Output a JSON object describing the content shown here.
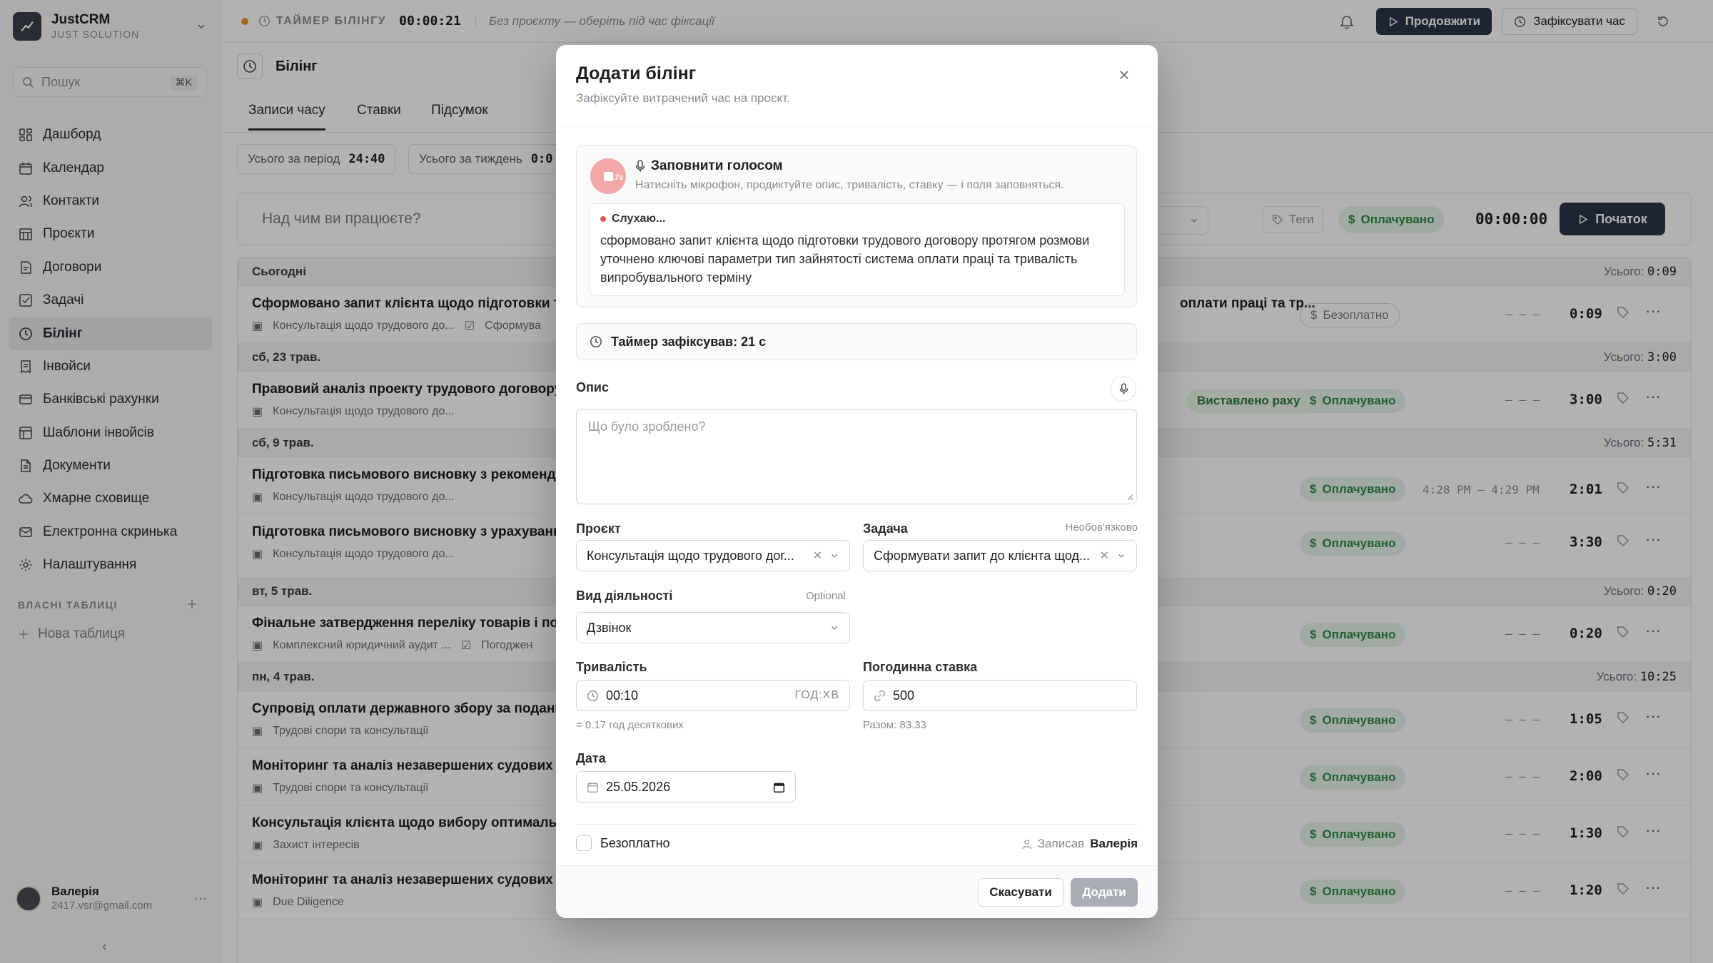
{
  "brand": {
    "name": "JustCRM",
    "subtitle": "JUST SOLUTION"
  },
  "search": {
    "placeholder": "Пошук",
    "shortcut": "⌘K"
  },
  "nav": [
    {
      "label": "Дашборд",
      "icon": "dashboard-icon"
    },
    {
      "label": "Календар",
      "icon": "calendar-icon"
    },
    {
      "label": "Контакти",
      "icon": "contacts-icon"
    },
    {
      "label": "Проєкти",
      "icon": "projects-icon"
    },
    {
      "label": "Договори",
      "icon": "contracts-icon"
    },
    {
      "label": "Задачі",
      "icon": "tasks-icon"
    },
    {
      "label": "Білінг",
      "icon": "billing-icon",
      "active": true
    },
    {
      "label": "Інвойси",
      "icon": "invoices-icon"
    },
    {
      "label": "Банківські рахунки",
      "icon": "bank-icon"
    },
    {
      "label": "Шаблони інвойсів",
      "icon": "templates-icon"
    },
    {
      "label": "Документи",
      "icon": "documents-icon"
    },
    {
      "label": "Хмарне сховище",
      "icon": "cloud-icon"
    },
    {
      "label": "Електронна скринька",
      "icon": "mail-icon"
    },
    {
      "label": "Налаштування",
      "icon": "settings-icon"
    }
  ],
  "custom_tables": {
    "label": "ВЛАСНІ ТАБЛИЦІ",
    "new": "Нова таблиця"
  },
  "user": {
    "name": "Валерія",
    "email": "2417.vsr@gmail.com"
  },
  "topbar": {
    "timer_label": "ТАЙМЕР БІЛІНГУ",
    "timer_value": "00:00:21",
    "project_hint": "Без проєкту — оберіть під час фіксації",
    "continue": "Продовжити",
    "fix_time": "Зафіксувати час"
  },
  "page": {
    "title": "Білінг",
    "tabs": [
      "Записи часу",
      "Ставки",
      "Підсумок"
    ],
    "total_period_label": "Усього за період",
    "total_period": "24:40",
    "total_week_label": "Усього за тиждень",
    "total_week": "0:0"
  },
  "workbar": {
    "placeholder": "Над чим ви працюєте?",
    "tags": "Теги",
    "billable": "Оплачувано",
    "time": "00:00:00",
    "start": "Початок"
  },
  "list": {
    "total_label": "Усього:",
    "days": [
      {
        "label": "Сьогодні",
        "total": "0:09"
      },
      {
        "label": "сб, 23 трав.",
        "total": "3:00"
      },
      {
        "label": "сб, 9 трав.",
        "total": "5:31"
      },
      {
        "label": "вт, 5 трав.",
        "total": "0:20"
      },
      {
        "label": "пн, 4 трав.",
        "total": "10:25"
      }
    ],
    "entries": [
      {
        "title": "Сформовано запит клієнта щодо підготовки тру",
        "tail": "оплати праці та тр...",
        "project": "Консультація щодо трудового до...",
        "task": "Сформува",
        "badge": "Безоплатно",
        "range": "– – –",
        "dur": "0:09"
      },
      {
        "title": "Правовий аналіз проекту трудового договору н",
        "project": "Консультація щодо трудового до...",
        "invoice": "Виставлено рахунок",
        "badge": "Оплачувано",
        "range": "– – –",
        "dur": "3:00"
      },
      {
        "title": "Підготовка письмового висновку з рекомендац",
        "project": "Консультація щодо трудового до...",
        "badge": "Оплачувано",
        "range": "4:28 PM – 4:29 PM",
        "dur": "2:01"
      },
      {
        "title": "Підготовка письмового висновку з урахування",
        "project": "Консультація щодо трудового до...",
        "badge": "Оплачувано",
        "range": "– – –",
        "dur": "3:30"
      },
      {
        "title": "Фінальне затвердження переліку товарів і посл",
        "project": "Комплексний юридичний аудит ...",
        "task": "Погоджен",
        "badge": "Оплачувано",
        "range": "– – –",
        "dur": "0:20"
      },
      {
        "title": "Супровід оплати державного збору за подання",
        "project": "Трудові спори та консультації",
        "badge": "Оплачувано",
        "range": "– – –",
        "dur": "1:05"
      },
      {
        "title": "Моніторинг та аналіз незавершених судових сп",
        "project": "Трудові спори та консультації",
        "badge": "Оплачувано",
        "range": "– – –",
        "dur": "2:00"
      },
      {
        "title": "Консультація клієнта щодо вибору оптимальни",
        "project": "Захист інтересів",
        "badge": "Оплачувано",
        "range": "– – –",
        "dur": "1:30"
      },
      {
        "title": "Моніторинг та аналіз незавершених судових сп",
        "project": "Due Diligence",
        "badge": "Оплачувано",
        "range": "– – –",
        "dur": "1:20"
      }
    ]
  },
  "modal": {
    "title": "Додати білінг",
    "subtitle": "Зафіксуйте витрачений час на проєкт.",
    "voice": {
      "title": "Заповнити голосом",
      "desc": "Натисніть мікрофон, продиктуйте опис, тривалість, ставку — і поля заповняться.",
      "rec_seconds": "17s",
      "listening": "Слухаю...",
      "transcript": "сформовано запит клієнта щодо підготовки трудового договору протягом розмови уточнено ключові параметри тип зайнятості система оплати праці та тривалість випробувального терміну"
    },
    "timer_fixed": "Таймер зафіксував: 21  с",
    "description": {
      "label": "Опис",
      "placeholder": "Що було зроблено?"
    },
    "project": {
      "label": "Проєкт",
      "value": "Консультація щодо трудового дог..."
    },
    "task": {
      "label": "Задача",
      "optional": "Необов'язково",
      "value": "Сформувати запит до клієнта щод..."
    },
    "activity": {
      "label": "Вид діяльності",
      "optional": "Optional",
      "value": "Дзвінок"
    },
    "duration": {
      "label": "Тривалість",
      "value": "00:10",
      "unit": "ГОД:ХВ",
      "hint": "= 0.17 год десяткових"
    },
    "rate": {
      "label": "Погодинна ставка",
      "value": "500",
      "hint": "Разом: 83.33"
    },
    "date": {
      "label": "Дата",
      "value": "25.05.2026"
    },
    "free_label": "Безоплатно",
    "recorded_label": "Записав",
    "recorded_by": "Валерія",
    "cancel": "Скасувати",
    "submit": "Додати"
  }
}
